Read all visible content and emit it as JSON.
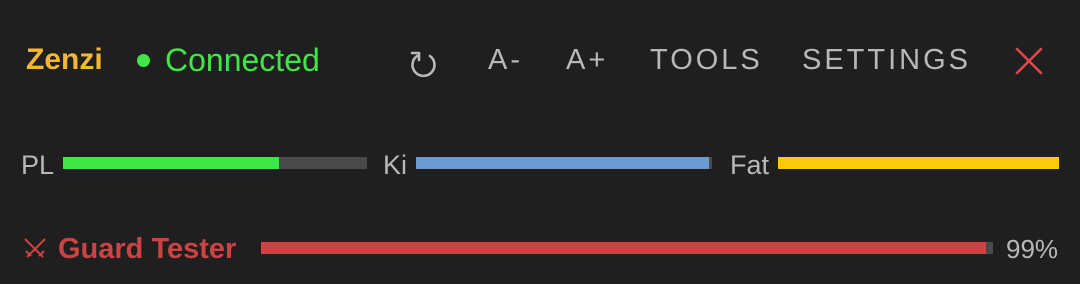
{
  "header": {
    "character_name": "Zenzi",
    "connection_status": "Connected",
    "buttons": {
      "font_smaller": "A-",
      "font_larger": "A+",
      "tools": "TOOLS",
      "settings": "SETTINGS"
    }
  },
  "stats": {
    "pl": {
      "label": "PL",
      "fraction": 0.71,
      "color": "#3fe645"
    },
    "ki": {
      "label": "Ki",
      "fraction": 0.99,
      "color": "#6b9bd2"
    },
    "fat": {
      "label": "Fat",
      "fraction": 1.0,
      "color": "#fec90a"
    }
  },
  "target": {
    "name": "Guard Tester",
    "percent_text": "99%",
    "fraction": 0.99,
    "color": "#cc4344"
  },
  "colors": {
    "background": "#1f1f1f",
    "name": "#f5b731",
    "connected": "#3fe645",
    "close": "#e04848",
    "muted_text": "#b8b8b8",
    "bar_track": "#4a4a4a"
  }
}
